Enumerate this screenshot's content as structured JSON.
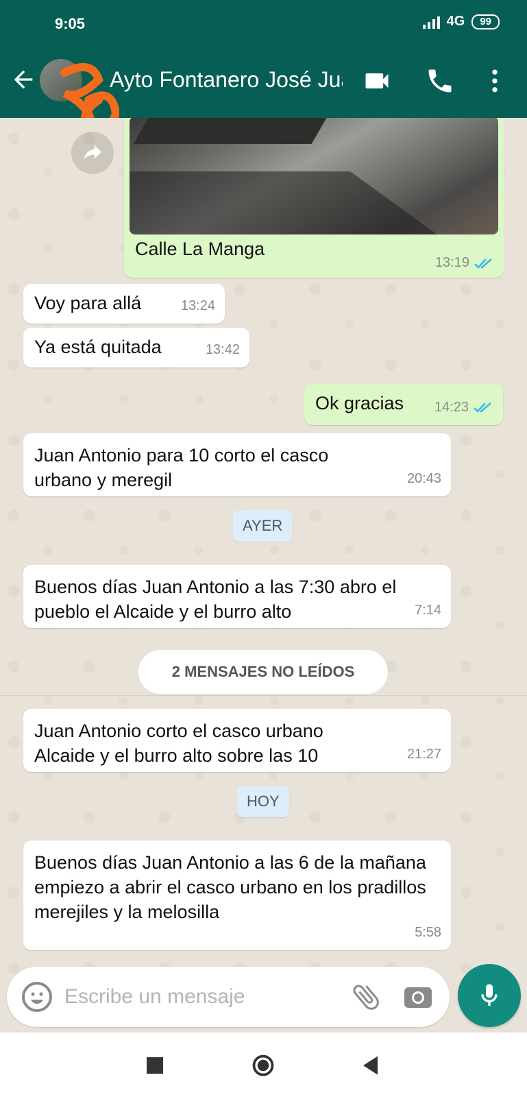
{
  "status_bar": {
    "time": "9:05",
    "network": "4G",
    "battery": "99"
  },
  "header": {
    "contact_name": "Ayto Fontanero José Juan Antonio",
    "icons": [
      "back-arrow-icon",
      "video-call-icon",
      "phone-icon",
      "more-vert-icon"
    ]
  },
  "messages": [
    {
      "type": "image",
      "direction": "out",
      "caption": "Calle La Manga",
      "time": "13:19",
      "read": true
    },
    {
      "direction": "in",
      "text": "Voy para allá",
      "time": "13:24"
    },
    {
      "direction": "in",
      "text": "Ya está quitada",
      "time": "13:42"
    },
    {
      "direction": "out",
      "text": "Ok gracias",
      "time": "14:23",
      "read": true
    },
    {
      "direction": "in",
      "text": "Juan Antonio para 10 corto el casco urbano y meregil",
      "time": "20:43"
    },
    {
      "direction": "in",
      "text": "Buenos días Juan Antonio a las 7:30 abro el pueblo el Alcaide y el burro alto",
      "time": "7:14"
    },
    {
      "direction": "in",
      "text": "Juan Antonio corto el casco urbano Alcaide y el burro alto sobre las 10",
      "time": "21:27"
    },
    {
      "direction": "in",
      "text": "Buenos días Juan Antonio a las 6 de la mañana empiezo a abrir el casco urbano en los pradillos merejiles y la melosilla",
      "time": "5:58"
    }
  ],
  "day_chips": {
    "yesterday": "AYER",
    "today": "HOY"
  },
  "unread_banner": "2 MENSAJES NO LEÍDOS",
  "composer": {
    "placeholder": "Escribe un mensaje"
  },
  "colors": {
    "primary": "#075e54",
    "accent": "#128c7e",
    "outgoing": "#dcf8c6",
    "read_ticks": "#34b7f1"
  }
}
